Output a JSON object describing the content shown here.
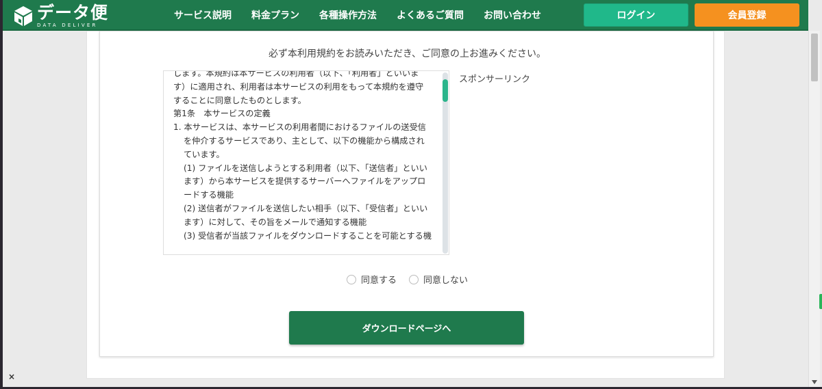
{
  "header": {
    "logo_title": "データ便",
    "logo_sub": "DATA DELIVER",
    "nav": [
      "サービス説明",
      "料金プラン",
      "各種操作方法",
      "よくあるご質問",
      "お問い合わせ"
    ],
    "login_label": "ログイン",
    "register_label": "会員登録"
  },
  "main": {
    "notice": "必ず本利用規約をお読みいただき、ご同意の上お進みください。",
    "sponsor_label": "スポンサーリンク",
    "terms": {
      "intro_lines": [
        "します。本規約は本サービスの利用者（以下、「利用者」といいま",
        "す）に適用され、利用者は本サービスの利用をもって本規約を遵守",
        "することに同意したものとします。"
      ],
      "heading": "第1条　本サービスの定義",
      "item1_lines": [
        "1. 本サービスは、本サービスの利用者間におけるファイルの送受信",
        "を仲介するサービスであり、主として、以下の機能から構成され",
        "ています。"
      ],
      "sub_lines": [
        "(1) ファイルを送信しようとする利用者（以下、「送信者」といい",
        "ます）から本サービスを提供するサーバーへファイルをアップロ",
        "ードする機能",
        "(2) 送信者がファイルを送信したい相手（以下、「受信者」といい",
        "ます）に対して、その旨をメールで通知する機能",
        "(3) 受信者が当該ファイルをダウンロードすることを可能とする機"
      ]
    },
    "agree_label": "同意する",
    "disagree_label": "同意しない",
    "download_label": "ダウンロードページへ"
  },
  "misc": {
    "close_label": "×"
  },
  "colors": {
    "brand_green": "#1f7a4d",
    "login_teal": "#20b88a",
    "register_orange": "#f5911f"
  }
}
